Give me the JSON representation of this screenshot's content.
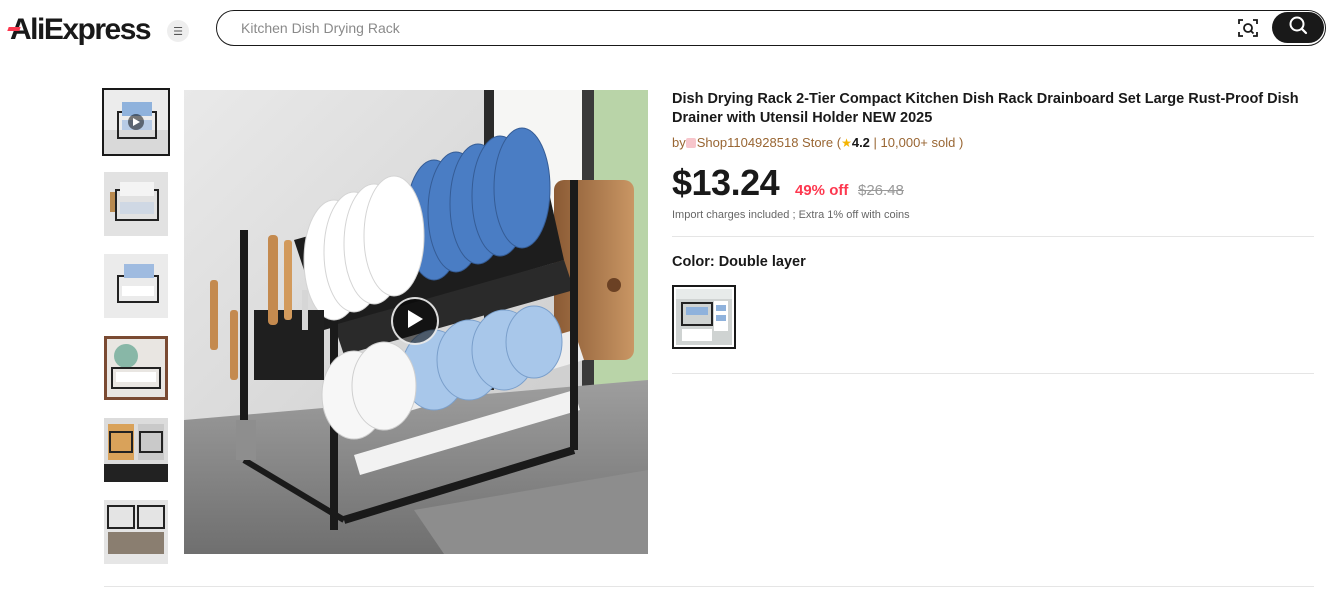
{
  "header": {
    "logo_text": "AliExpress",
    "search": {
      "placeholder": "Kitchen Dish Drying Rack",
      "value": ""
    }
  },
  "gallery": {
    "thumbnails": [
      {
        "label": "video thumbnail",
        "active": true
      },
      {
        "label": "product image 2"
      },
      {
        "label": "product image 3"
      },
      {
        "label": "product image 4"
      },
      {
        "label": "product image 5"
      },
      {
        "label": "product image 6"
      }
    ]
  },
  "product": {
    "title": "Dish Drying Rack 2-Tier Compact Kitchen Dish Rack Drainboard Set Large Rust-Proof Dish Drainer with Utensil Holder NEW 2025",
    "store": {
      "by": "by",
      "name": "Shop1104928518 Store",
      "open_paren": " (",
      "rating": "4.2",
      "separator": " | ",
      "sold": "10,000+ sold",
      "close_paren": " )"
    },
    "price": "$13.24",
    "discount": "49% off",
    "original_price": "$26.48",
    "tax_note": "Import charges included ; Extra 1% off with coins",
    "color": {
      "label": "Color: Double layer",
      "selected": "Double layer"
    }
  },
  "colors": {
    "brand_red": "#fd384f",
    "text": "#191919",
    "store_brown": "#996633",
    "star": "#f5b400"
  }
}
